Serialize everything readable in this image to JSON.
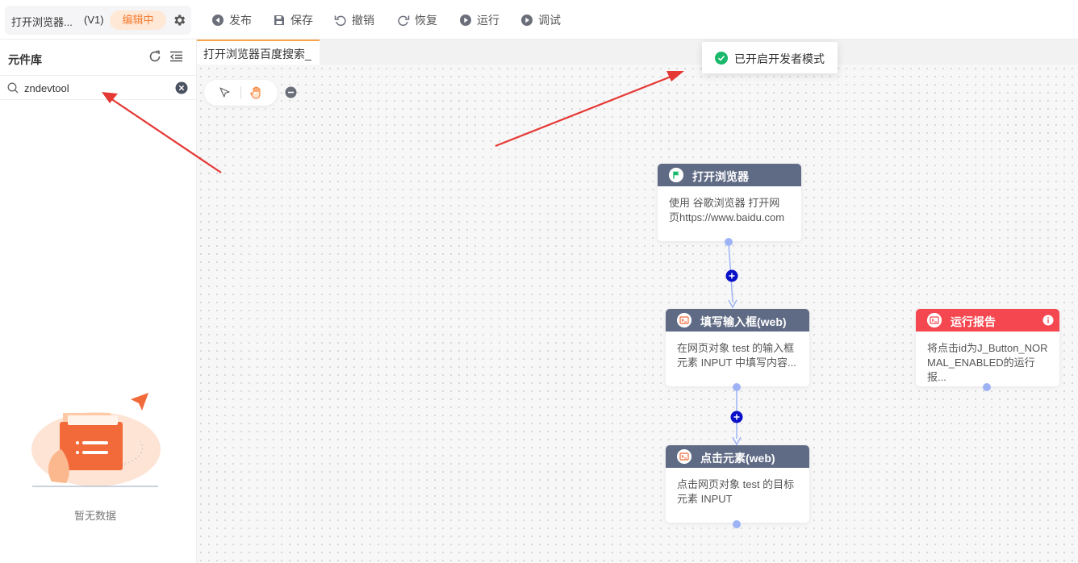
{
  "header": {
    "project_name": "打开浏览器...",
    "version": "(V1)",
    "status_badge": "编辑中",
    "toolbar": {
      "publish": "发布",
      "save": "保存",
      "undo": "撤销",
      "redo": "恢复",
      "run": "运行",
      "debug": "调试"
    }
  },
  "sidebar": {
    "title": "元件库",
    "search": {
      "value": "zndevtool"
    },
    "empty_text": "暂无数据"
  },
  "canvas": {
    "tab_label": "打开浏览器百度搜索_",
    "toast": "已开启开发者模式",
    "nodes": {
      "open_browser": {
        "title": "打开浏览器",
        "line1": "使用 谷歌浏览器 打开网",
        "line2": "页https://www.baidu.com"
      },
      "fill_input": {
        "title": "填写输入框(web)",
        "line1": "在网页对象 test 的输入框",
        "line2": "元素 INPUT 中填写内容..."
      },
      "click_element": {
        "title": "点击元素(web)",
        "line1": "点击网页对象 test 的目标",
        "line2": "元素 INPUT"
      },
      "run_report": {
        "title": "运行报告",
        "line1": "将点击id为J_Button_NOR",
        "line2": "MAL_ENABLED的运行报..."
      }
    }
  },
  "colors": {
    "accent_orange": "#f57c32",
    "node_header": "#5f6a84",
    "report_header": "#f5474f",
    "connector": "#9db3f5",
    "add_button": "#0a10c8",
    "annotation_arrow": "#e53935",
    "success": "#19b86b"
  },
  "icons": [
    "gear-icon",
    "publish-icon",
    "save-icon",
    "undo-icon",
    "redo-icon",
    "run-icon",
    "debug-icon",
    "refresh-icon",
    "collapse-icon",
    "search-icon",
    "clear-icon",
    "pointer-icon",
    "hand-icon",
    "zoom-out-icon",
    "check-icon",
    "flag-icon",
    "terminal-icon",
    "info-icon"
  ]
}
